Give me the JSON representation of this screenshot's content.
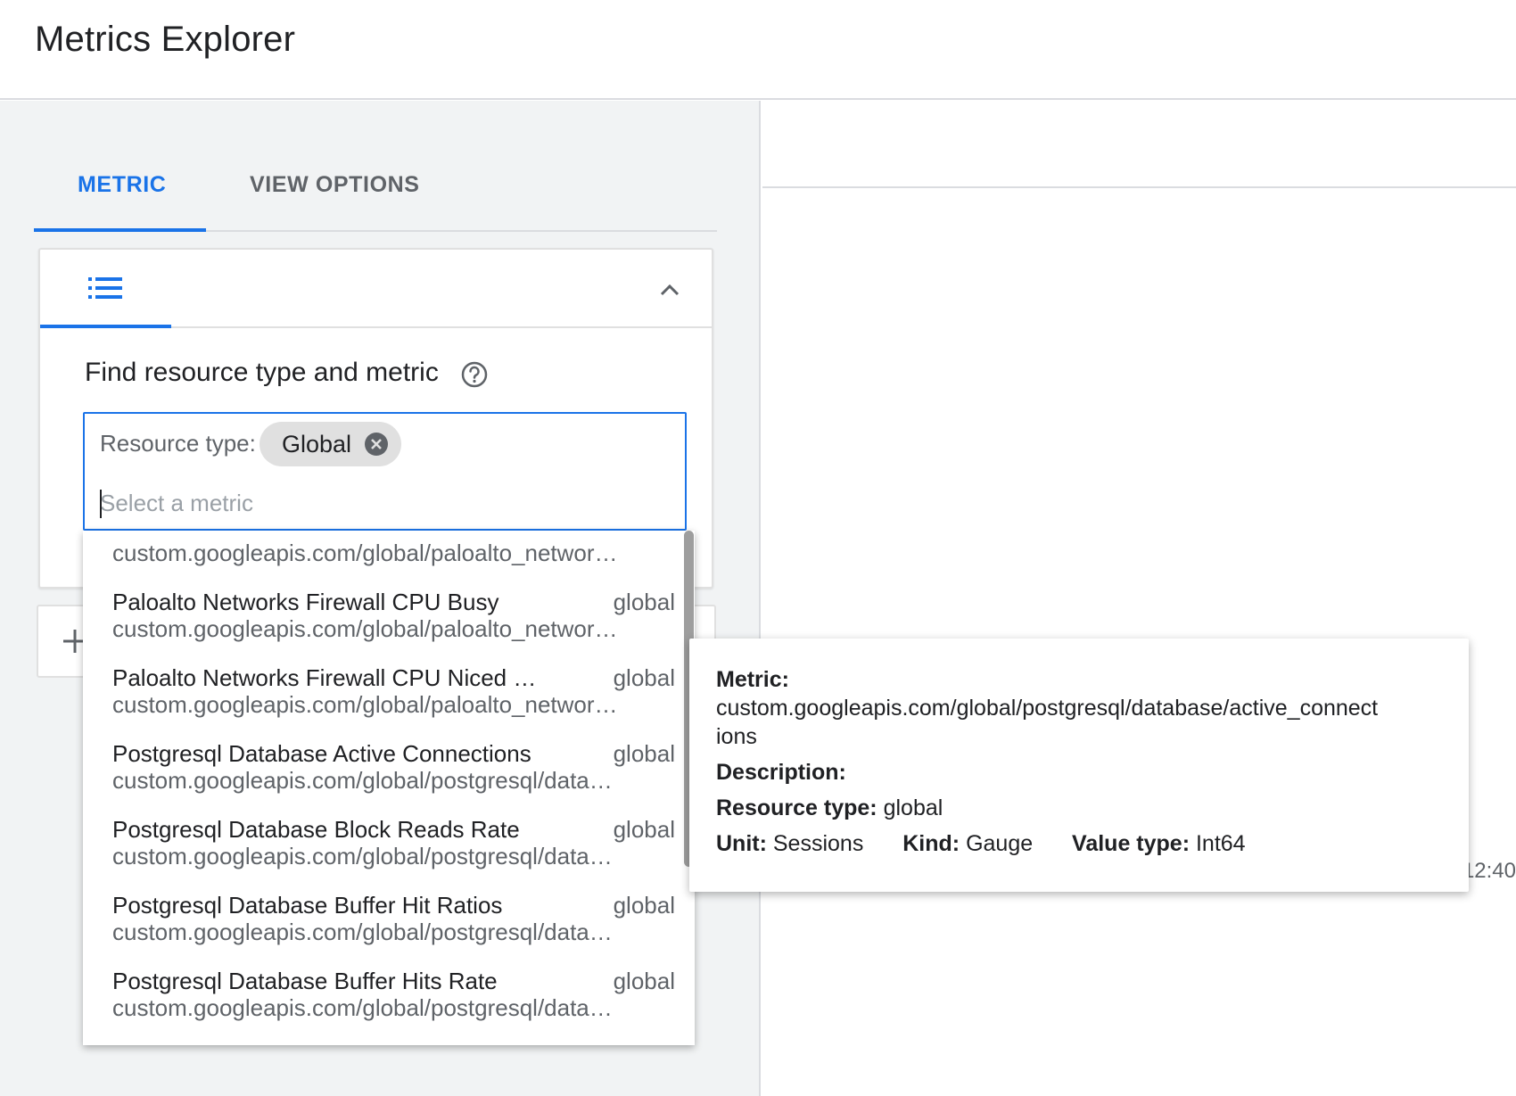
{
  "header": {
    "title": "Metrics Explorer"
  },
  "tabs": [
    {
      "label": "METRIC"
    },
    {
      "label": "VIEW OPTIONS"
    }
  ],
  "card": {
    "find_title": "Find resource type and metric",
    "resource_type_label": "Resource type:",
    "resource_chip": "Global",
    "metric_placeholder": "Select a metric"
  },
  "dropdown": {
    "items": [
      {
        "name": "",
        "resource": "",
        "path": "custom.googleapis.com/global/paloalto_networ…"
      },
      {
        "name": "Paloalto Networks Firewall CPU Busy",
        "resource": "global",
        "path": "custom.googleapis.com/global/paloalto_networ…"
      },
      {
        "name": "Paloalto Networks Firewall CPU Niced U…",
        "resource": "global",
        "path": "custom.googleapis.com/global/paloalto_networ…"
      },
      {
        "name": "Postgresql Database Active Connections",
        "resource": "global",
        "path": "custom.googleapis.com/global/postgresql/data…"
      },
      {
        "name": "Postgresql Database Block Reads Rate",
        "resource": "global",
        "path": "custom.googleapis.com/global/postgresql/data…"
      },
      {
        "name": "Postgresql Database Buffer Hit Ratios",
        "resource": "global",
        "path": "custom.googleapis.com/global/postgresql/data…"
      },
      {
        "name": "Postgresql Database Buffer Hits Rate",
        "resource": "global",
        "path": "custom.googleapis.com/global/postgresql/data…"
      }
    ]
  },
  "tooltip": {
    "metric_label": "Metric:",
    "metric_value_line1": "custom.googleapis.com/global/postgresql/database/active_connect",
    "metric_value_line2": "ions",
    "description_label": "Description:",
    "resource_type_label": "Resource type:",
    "resource_type_value": "global",
    "unit_label": "Unit:",
    "unit_value": "Sessions",
    "kind_label": "Kind:",
    "kind_value": "Gauge",
    "value_type_label": "Value type:",
    "value_type_value": "Int64"
  },
  "chart": {
    "time_label": "12:40"
  },
  "colors": {
    "accent": "#1a73e8",
    "panel_bg": "#f1f3f4",
    "chip_bg": "#e0e0e0"
  },
  "icons": [
    "list-icon",
    "chevron-up-icon",
    "help-icon",
    "close-circle-icon",
    "plus-icon"
  ]
}
